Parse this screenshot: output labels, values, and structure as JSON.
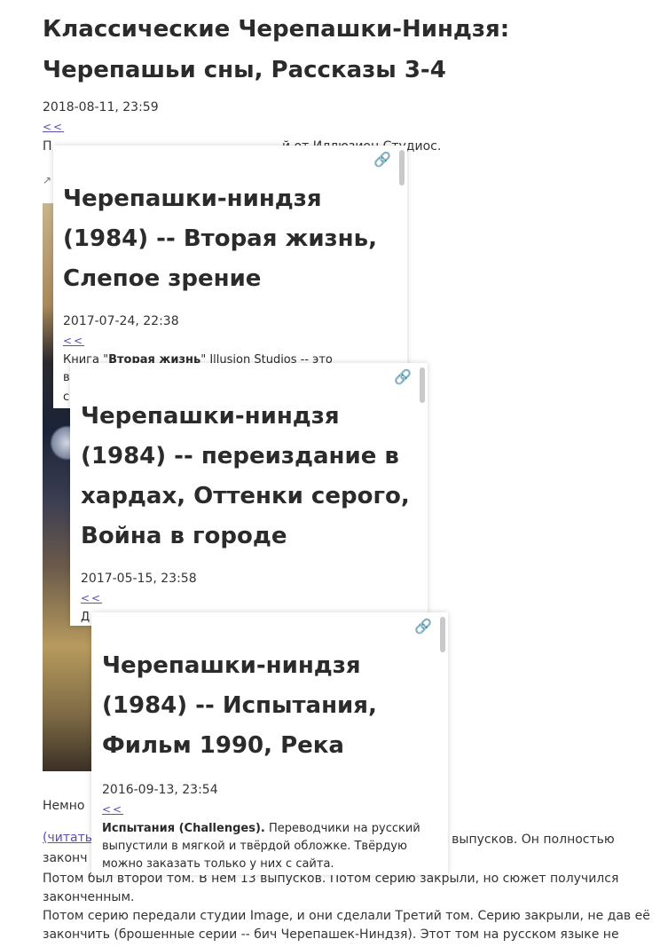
{
  "article": {
    "title": "Классические Черепашки-Ниндзя: Черепашьи сны, Рассказы 3-4",
    "date": "2018-08-11, 23:59",
    "back": "<<",
    "line1_start": "П",
    "line1_end": "й от Иллюзион Студиос.",
    "intro_fragment": "Немно",
    "readmore_fragment": "(читать",
    "para_fragment_right": "то выпусков. Он полностью",
    "para_fragment_left": "законч",
    "line_vol2_a": "Потом был второй том. В нём 13 выпусков. Потом серию закрыли, но сюжет получился",
    "line_vol2_b": "законченным.",
    "line_vol3_a": "Потом серию передали студии Image, и они сделали Третий том. Серию закрыли, не дав её",
    "line_vol3_b": "закончить (брошенные серии -- бич Черепашек-Ниндзя). Этот том на русском языке не"
  },
  "popups": [
    {
      "title": "Черепашки-ниндзя (1984) -- Вторая жизнь, Слепое зрение",
      "date": "2017-07-24, 22:38",
      "back": "<<",
      "text_prefix": "Книга \"",
      "text_bold": "Вторая жизнь",
      "text_suffix": "\" Illusion Studios -- это",
      "line2_start": "в",
      "line3_start": "с"
    },
    {
      "title": "Черепашки-ниндзя (1984) -- переиздание в хардах, Оттенки серого, Война в городе",
      "date": "2017-05-15, 23:58",
      "back": "<<",
      "text_start": "Д"
    },
    {
      "title": "Черепашки-ниндзя (1984) -- Испытания, Фильм 1990, Река",
      "date": "2016-09-13, 23:54",
      "back": "<<",
      "text_bold": "Испытания (Challenges).",
      "text_rest": " Переводчики на русский выпустили в мягкой и твёрдой обложке. Твёрдую можно заказать только у них с сайта."
    }
  ],
  "icons": {
    "link": "chain-link-icon",
    "share": "share-icon"
  },
  "colors": {
    "link": "#5b4fb5",
    "text": "#2a2a2a"
  }
}
